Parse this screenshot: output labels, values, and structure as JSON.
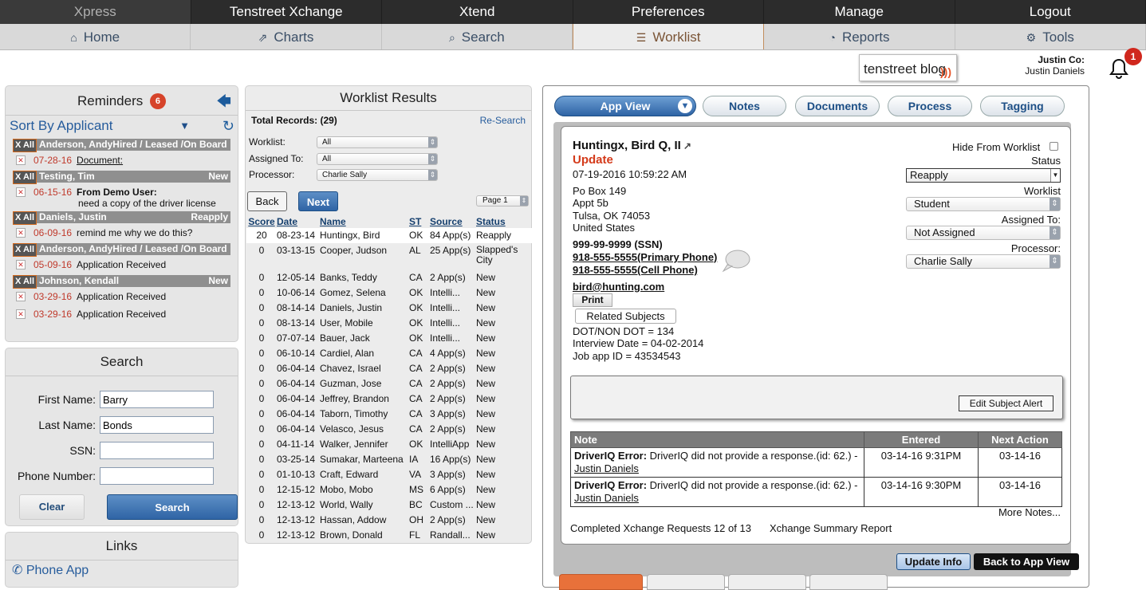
{
  "topnav": [
    "Xpress",
    "Tenstreet Xchange",
    "Xtend",
    "Preferences",
    "Manage",
    "Logout"
  ],
  "subnav": [
    {
      "label": "Home",
      "icon": "home-icon",
      "glyph": "⌂"
    },
    {
      "label": "Charts",
      "icon": "line-chart-icon",
      "glyph": "⇗"
    },
    {
      "label": "Search",
      "icon": "search-icon",
      "glyph": "⌕"
    },
    {
      "label": "Worklist",
      "icon": "list-icon",
      "glyph": "☰"
    },
    {
      "label": "Reports",
      "icon": "dashboard-icon",
      "glyph": "◔"
    },
    {
      "label": "Tools",
      "icon": "gears-icon",
      "glyph": "⚙"
    }
  ],
  "active_subnav": "Worklist",
  "blog": {
    "label": "tenstreet blog"
  },
  "user": {
    "company": "Justin Co:",
    "name": "Justin Daniels"
  },
  "notifications": {
    "count": "1"
  },
  "reminders": {
    "title": "Reminders",
    "count": "6",
    "sort_label": "Sort By Applicant",
    "groups": [
      {
        "xall": "X All",
        "name": "Anderson, AndyHired / Leased /On Board",
        "status": "",
        "items": [
          {
            "date": "07-28-16",
            "text": "Document:",
            "style": "ul",
            "extra": ""
          }
        ]
      },
      {
        "xall": "X All",
        "name": "Testing, Tim",
        "status": "New",
        "items": [
          {
            "date": "06-15-16",
            "text": "From Demo User:",
            "style": "bo",
            "extra": "need a copy of the driver license"
          }
        ]
      },
      {
        "xall": "X All",
        "name": "Daniels, Justin",
        "status": "Reapply",
        "items": [
          {
            "date": "06-09-16",
            "text": "remind me why we do this?",
            "style": "",
            "extra": ""
          }
        ]
      },
      {
        "xall": "X All",
        "name": "Anderson, AndyHired / Leased /On Board",
        "status": "",
        "items": [
          {
            "date": "05-09-16",
            "text": "Application Received",
            "style": "",
            "extra": ""
          }
        ]
      },
      {
        "xall": "X All",
        "name": "Johnson, Kendall",
        "status": "New",
        "items": [
          {
            "date": "03-29-16",
            "text": "Application Received",
            "style": "",
            "extra": ""
          },
          {
            "date": "03-29-16",
            "text": "Application Received",
            "style": "",
            "extra": ""
          }
        ]
      }
    ]
  },
  "search": {
    "title": "Search",
    "fields": [
      {
        "label": "First Name:",
        "value": "Barry"
      },
      {
        "label": "Last Name:",
        "value": "Bonds"
      },
      {
        "label": "SSN:",
        "value": ""
      },
      {
        "label": "Phone Number:",
        "value": ""
      }
    ],
    "clear_label": "Clear",
    "search_label": "Search"
  },
  "links": {
    "title": "Links",
    "items": [
      "Phone App"
    ]
  },
  "worklist": {
    "title": "Worklist Results",
    "total_label": "Total Records: (29)",
    "research_label": "Re-Search",
    "filters": [
      {
        "label": "Worklist:",
        "value": "All"
      },
      {
        "label": "Assigned To:",
        "value": "All"
      },
      {
        "label": "Processor:",
        "value": "Charlie Sally"
      }
    ],
    "back_label": "Back",
    "next_label": "Next",
    "page_label": "Page 1",
    "columns": [
      "Score",
      "Date",
      "Name",
      "ST",
      "Source",
      "Status"
    ],
    "rows": [
      [
        "20",
        "08-23-14",
        "Huntingx, Bird",
        "OK",
        "84 App(s)",
        "Reapply"
      ],
      [
        "0",
        "03-13-15",
        "Cooper, Judson",
        "AL",
        "25 App(s)",
        "Slapped's City"
      ],
      [
        "0",
        "12-05-14",
        "Banks, Teddy",
        "CA",
        "2 App(s)",
        "New"
      ],
      [
        "0",
        "10-06-14",
        "Gomez, Selena",
        "OK",
        "Intelli...",
        "New"
      ],
      [
        "0",
        "08-14-14",
        "Daniels, Justin",
        "OK",
        "Intelli...",
        "New"
      ],
      [
        "0",
        "08-13-14",
        "User, Mobile",
        "OK",
        "Intelli...",
        "New"
      ],
      [
        "0",
        "07-07-14",
        "Bauer, Jack",
        "OK",
        "Intelli...",
        "New"
      ],
      [
        "0",
        "06-10-14",
        "Cardiel, Alan",
        "CA",
        "4 App(s)",
        "New"
      ],
      [
        "0",
        "06-04-14",
        "Chavez, Israel",
        "CA",
        "2 App(s)",
        "New"
      ],
      [
        "0",
        "06-04-14",
        "Guzman, Jose",
        "CA",
        "2 App(s)",
        "New"
      ],
      [
        "0",
        "06-04-14",
        "Jeffrey, Brandon",
        "CA",
        "2 App(s)",
        "New"
      ],
      [
        "0",
        "06-04-14",
        "Taborn, Timothy",
        "CA",
        "3 App(s)",
        "New"
      ],
      [
        "0",
        "06-04-14",
        "Velasco, Jesus",
        "CA",
        "2 App(s)",
        "New"
      ],
      [
        "0",
        "04-11-14",
        "Walker, Jennifer",
        "OK",
        "IntelliApp",
        "New"
      ],
      [
        "0",
        "03-25-14",
        "Sumakar, Marteena",
        "IA",
        "16 App(s)",
        "New"
      ],
      [
        "0",
        "01-10-13",
        "Craft, Edward",
        "VA",
        "3 App(s)",
        "New"
      ],
      [
        "0",
        "12-15-12",
        "Mobo, Mobo",
        "MS",
        "6 App(s)",
        "New"
      ],
      [
        "0",
        "12-13-12",
        "World, Wally",
        "BC",
        "Custom ...",
        "New"
      ],
      [
        "0",
        "12-13-12",
        "Hassan, Addow",
        "OH",
        "2 App(s)",
        "New"
      ],
      [
        "0",
        "12-13-12",
        "Brown, Donald",
        "FL",
        "Randall...",
        "New"
      ]
    ]
  },
  "app": {
    "tabs": [
      "App View",
      "Notes",
      "Documents",
      "Process",
      "Tagging"
    ],
    "name": "Huntingx, Bird Q, II",
    "type": "Update",
    "datetime": "07-19-2016 10:59:22 AM",
    "address": [
      "Po Box 149",
      "Appt 5b",
      "Tulsa, OK 74053",
      "United States"
    ],
    "ssn": "999-99-9999 (SSN)",
    "primary_phone": "918-555-5555(Primary Phone)",
    "cell_phone": "918-555-5555(Cell Phone)",
    "email": "bird@hunting.com",
    "print_label": "Print",
    "related_label": "Related Subjects",
    "dot": "DOT/NON DOT = 134",
    "interview": "Interview Date = 04-02-2014",
    "jobapp": "Job app ID = 43534543",
    "hide_label": "Hide From Worklist",
    "status_label": "Status",
    "status_value": "Reapply",
    "worklist_label": "Worklist",
    "worklist_value": "Student",
    "assigned_label": "Assigned To:",
    "assigned_value": "Not Assigned",
    "processor_label": "Processor:",
    "processor_value": "Charlie Sally",
    "edit_alert_label": "Edit Subject Alert",
    "notes_columns": [
      "Note",
      "Entered",
      "Next Action"
    ],
    "notes": [
      {
        "title": "DriverIQ Error:",
        "text": " DriverIQ did not provide a response.(id: 62.) -",
        "author": "Justin Daniels",
        "entered": "03-14-16 9:31PM",
        "next": "03-14-16"
      },
      {
        "title": "DriverIQ Error:",
        "text": " DriverIQ did not provide a response.(id: 62.) -",
        "author": "Justin Daniels",
        "entered": "03-14-16 9:30PM",
        "next": "03-14-16"
      }
    ],
    "more_notes": "More Notes...",
    "xchange_requests": "Completed Xchange Requests 12 of 13",
    "xchange_summary": "Xchange Summary Report",
    "update_label": "Update Info",
    "back_app_label": "Back to App View"
  }
}
